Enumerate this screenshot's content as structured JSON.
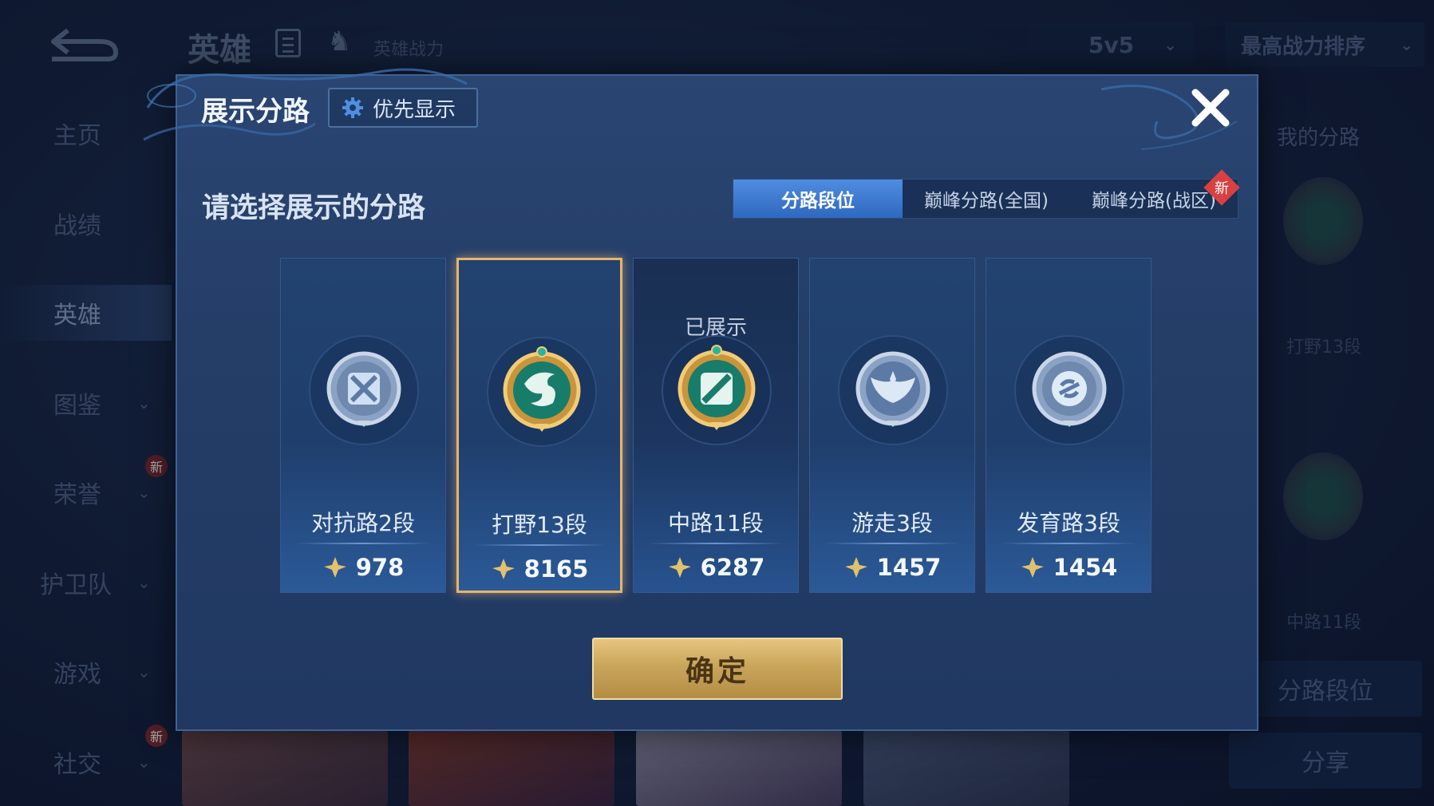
{
  "background": {
    "top_title": "英雄",
    "top_sub": "英雄战力",
    "mode_select": "5v5",
    "sort_select": "最高战力排序",
    "nav": [
      {
        "label": "主页",
        "chev": false,
        "badge": ""
      },
      {
        "label": "战绩",
        "chev": false,
        "badge": ""
      },
      {
        "label": "英雄",
        "chev": false,
        "badge": ""
      },
      {
        "label": "图鉴",
        "chev": true,
        "badge": ""
      },
      {
        "label": "荣誉",
        "chev": true,
        "badge": "新"
      },
      {
        "label": "护卫队",
        "chev": true,
        "badge": ""
      },
      {
        "label": "游戏",
        "chev": true,
        "badge": ""
      },
      {
        "label": "社交",
        "chev": true,
        "badge": "新"
      }
    ],
    "right_panel": {
      "title": "我的分路",
      "item1_label": "打野13段",
      "item2_label": "中路11段",
      "btn_lane": "分路段位",
      "btn_share": "分享"
    }
  },
  "modal": {
    "title": "展示分路",
    "priority_button": "优先显示",
    "prompt": "请选择展示的分路",
    "tabs": [
      {
        "label": "分路段位",
        "active": true,
        "new": ""
      },
      {
        "label": "巅峰分路(全国)",
        "active": false,
        "new": ""
      },
      {
        "label": "巅峰分路(战区)",
        "active": false,
        "new": "新"
      }
    ],
    "shown_label": "已展示",
    "cards": [
      {
        "name": "对抗路2段",
        "score": "978",
        "icon": "crossed-swords-icon",
        "tier": "silver",
        "selected": false,
        "shown": false
      },
      {
        "name": "打野13段",
        "score": "8165",
        "icon": "dragon-icon",
        "tier": "gold",
        "selected": true,
        "shown": false
      },
      {
        "name": "中路11段",
        "score": "6287",
        "icon": "mid-lane-icon",
        "tier": "gold",
        "selected": false,
        "shown": true
      },
      {
        "name": "游走3段",
        "score": "1457",
        "icon": "wings-icon",
        "tier": "silver",
        "selected": false,
        "shown": false
      },
      {
        "name": "发育路3段",
        "score": "1454",
        "icon": "marksman-icon",
        "tier": "silver",
        "selected": false,
        "shown": false
      }
    ],
    "confirm_button": "确定"
  },
  "colors": {
    "accent_blue": "#3a79d0",
    "gold_border": "#e8b46a",
    "confirm_gold": "#c9a55a",
    "new_badge_red": "#d94040"
  }
}
